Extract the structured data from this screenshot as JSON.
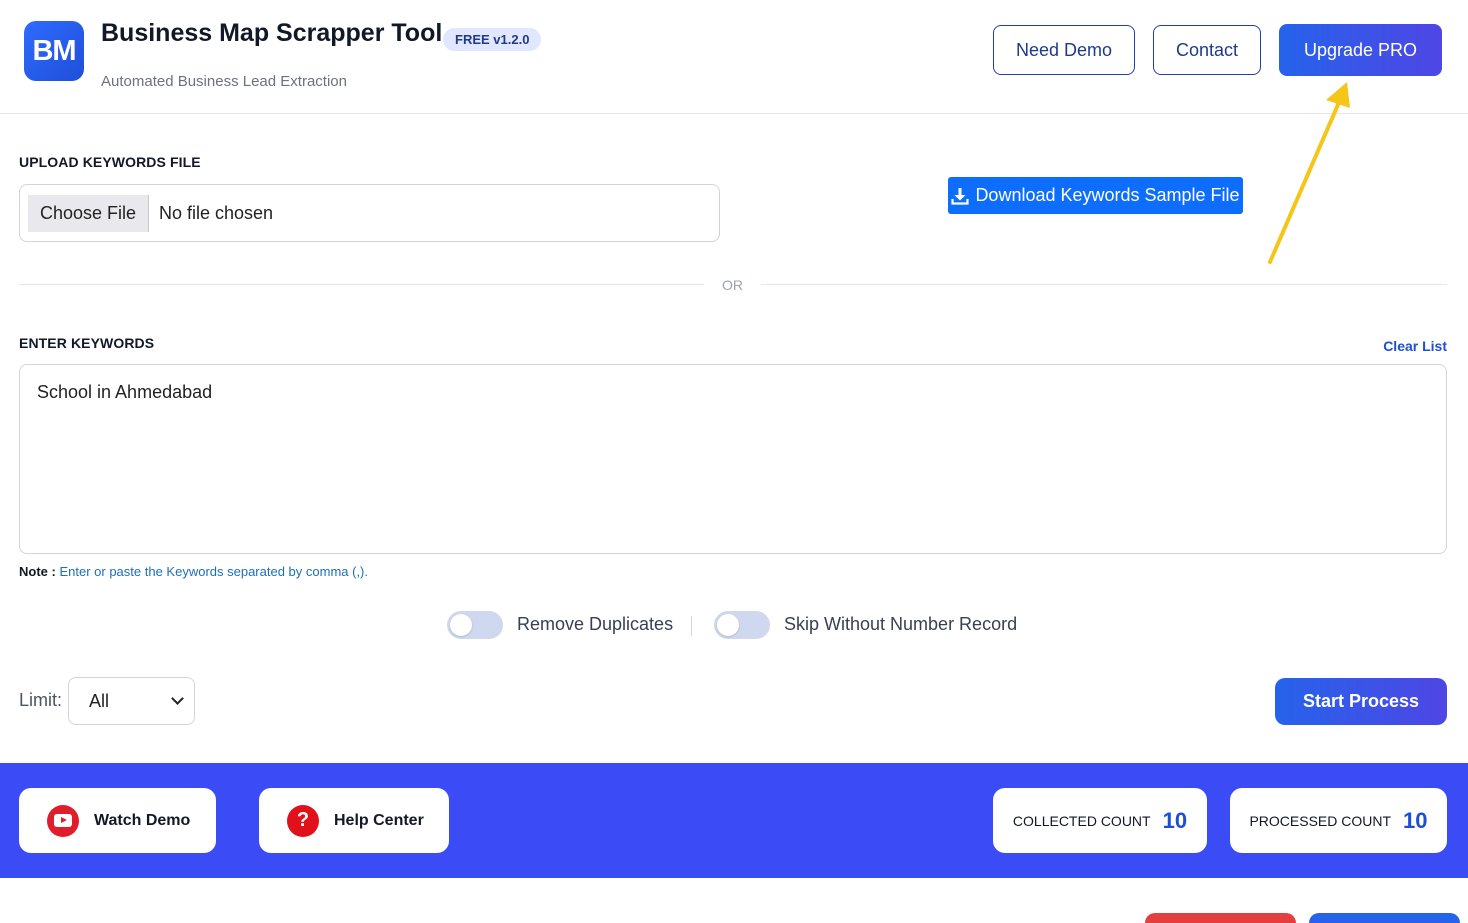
{
  "header": {
    "logo_text": "BM",
    "title": "Business Map Scrapper Tool",
    "version_badge": "FREE v1.2.0",
    "subtitle": "Automated Business Lead Extraction",
    "buttons": {
      "need_demo": "Need Demo",
      "contact": "Contact",
      "upgrade": "Upgrade PRO"
    }
  },
  "upload": {
    "label": "UPLOAD KEYWORDS FILE",
    "choose_file": "Choose File",
    "file_status": "No file chosen",
    "download_button": "Download Keywords Sample File",
    "download_icon": "download-icon"
  },
  "divider": {
    "or_text": "OR"
  },
  "keywords": {
    "label": "ENTER KEYWORDS",
    "clear_list": "Clear List",
    "value": "School in Ahmedabad",
    "note_key": "Note :",
    "note_text": "Enter or paste the Keywords separated by comma (,)."
  },
  "options": {
    "remove_duplicates": {
      "label": "Remove Duplicates",
      "enabled": false
    },
    "skip_without_number": {
      "label": "Skip Without Number Record",
      "enabled": false
    }
  },
  "limit": {
    "label": "Limit:",
    "selected": "All"
  },
  "actions": {
    "start": "Start Process"
  },
  "footer": {
    "watch_demo": "Watch Demo",
    "watch_demo_icon": "youtube-icon",
    "help_center": "Help Center",
    "help_center_icon": "help-icon",
    "collected_label": "COLLECTED COUNT",
    "collected_value": "10",
    "processed_label": "PROCESSED COUNT",
    "processed_value": "10"
  },
  "colors": {
    "primary": "#2563eb",
    "footer_bar": "#3b4cf6",
    "annotation_arrow": "#f5c518",
    "note_text": "#1d6fb8"
  }
}
